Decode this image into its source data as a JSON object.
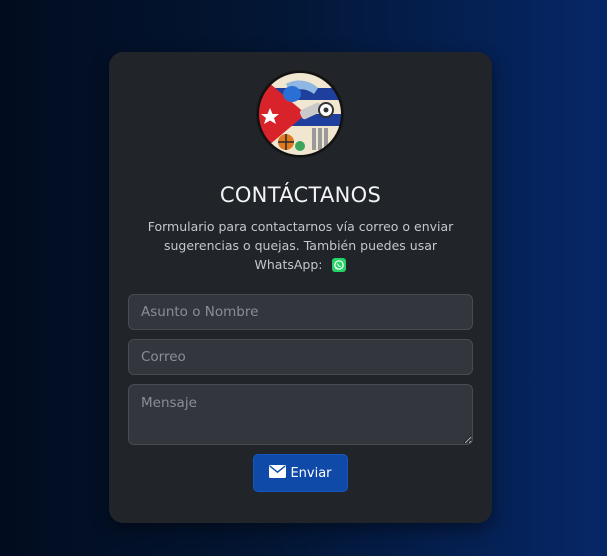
{
  "header": {
    "title": "CONTÁCTANOS",
    "description": "Formulario para contactarnos vía correo o enviar sugerencias o quejas. También puedes usar WhatsApp:",
    "whatsapp_icon": "whatsapp-icon"
  },
  "form": {
    "subject_placeholder": "Asunto o Nombre",
    "email_placeholder": "Correo",
    "message_placeholder": "Mensaje",
    "submit_label": "Enviar",
    "submit_icon": "envelope-icon"
  },
  "colors": {
    "card_background": "#212429",
    "button_background": "#0f4aa8",
    "input_background": "#33363c",
    "whatsapp_green": "#25d366"
  }
}
